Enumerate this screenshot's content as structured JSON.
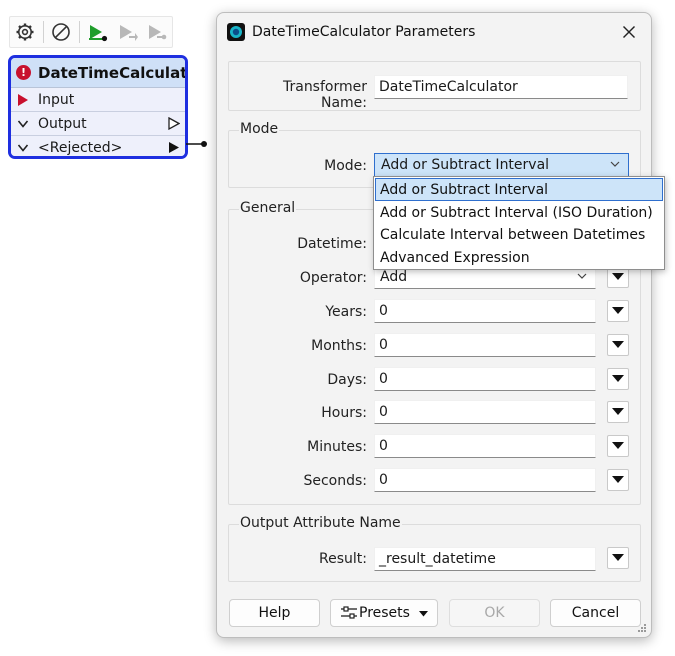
{
  "node": {
    "title": "DateTimeCalculator",
    "ports": [
      {
        "label": "Input"
      },
      {
        "label": "Output"
      },
      {
        "label": "<Rejected>"
      }
    ]
  },
  "dialog": {
    "title": "DateTimeCalculator Parameters",
    "transformer_name_label": "Transformer Name:",
    "transformer_name": "DateTimeCalculator",
    "mode_group": "Mode",
    "mode_label": "Mode:",
    "mode_value": "Add or Subtract Interval",
    "mode_options": [
      "Add or Subtract Interval",
      "Add or Subtract Interval (ISO Duration)",
      "Calculate Interval between Datetimes",
      "Advanced Expression"
    ],
    "general_group": "General",
    "fields": [
      {
        "label": "Datetime:",
        "value": ""
      },
      {
        "label": "Operator:",
        "value": "Add"
      },
      {
        "label": "Years:",
        "value": "0"
      },
      {
        "label": "Months:",
        "value": "0"
      },
      {
        "label": "Days:",
        "value": "0"
      },
      {
        "label": "Hours:",
        "value": "0"
      },
      {
        "label": "Minutes:",
        "value": "0"
      },
      {
        "label": "Seconds:",
        "value": "0"
      }
    ],
    "output_group": "Output Attribute Name",
    "result_label": "Result:",
    "result_value": "_result_datetime",
    "buttons": {
      "help": "Help",
      "presets": "Presets",
      "ok": "OK",
      "cancel": "Cancel"
    }
  },
  "colors": {
    "node_border": "#1e2fe0",
    "node_title_bg": "#cfe0f7",
    "error_red": "#c8102e",
    "run_green": "#1f9d2b",
    "selection_bg": "#cde4f9",
    "selection_border": "#2f6fce"
  },
  "icons": [
    "gear-icon",
    "disable-icon",
    "run-icon",
    "run-from-icon",
    "run-to-icon",
    "error-icon",
    "close-icon",
    "chevron-down-icon",
    "presets-icon",
    "resize-grip-icon"
  ]
}
